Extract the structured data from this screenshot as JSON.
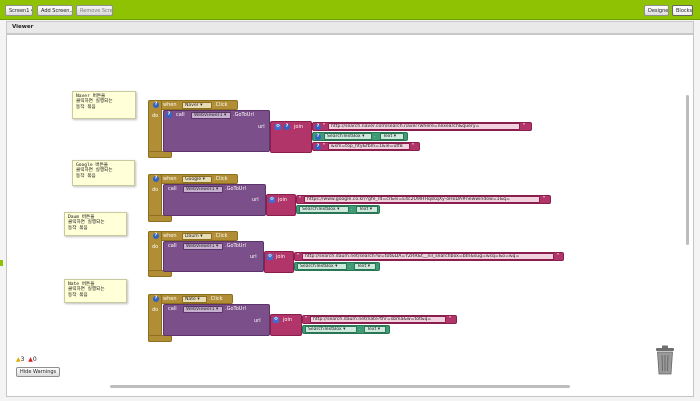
{
  "toolbar": {
    "screen_label": "Screen1",
    "add_screen_label": "Add Screen...",
    "remove_screen_label": "Remove Screen",
    "designer_label": "Designer",
    "blocks_label": "Blocks"
  },
  "viewer": {
    "title": "Viewer"
  },
  "comments": [
    {
      "text": "Naver 버튼을\n클릭하면 실행되는\n동작 묶음"
    },
    {
      "text": "Google 버튼을\n클릭하면 실행되는\n동작 묶음"
    },
    {
      "text": "Daum 버튼을\n클릭하면 실행되는\n동작 묶음"
    },
    {
      "text": "Nate 버튼을\n클릭하면 실행되는\n동작 묶음"
    }
  ],
  "blocks_common": {
    "when": "when",
    "do": "do",
    "call": "call",
    "url": "url",
    "join": "join",
    "click": ".Click",
    "gotourl": ".GoToUrl",
    "webviewer": "WebViewer1 ▾",
    "textbox": "SearchTextBox ▾",
    "text_prop": "Text ▾",
    "dot": "."
  },
  "events": [
    {
      "button": "Naver ▾",
      "strings": [
        "http://search.naver.com/search.naver?where=nexearch&query=",
        "&sm=top_hty&fbm=1&ie=utf8"
      ]
    },
    {
      "button": "Google ▾",
      "strings": [
        "https://www.google.co.kr/?gfe_rd=cr&ei=E4c2U9lHHqskqXy-oHoDA#newwindow=1&q="
      ]
    },
    {
      "button": "Daum ▾",
      "strings": [
        "http://search.daum.net/search?w=tot&DA=YZRR&t__nil_searchbox=btn&sug=&sq=&o=&q="
      ]
    },
    {
      "button": "Nate ▾",
      "strings": [
        "http://search.daum.net/nate?thr=sbma&w=tot&q="
      ]
    }
  ],
  "warnings": {
    "warning_count": "3",
    "error_count": "0",
    "hide_label": "Hide Warnings"
  }
}
